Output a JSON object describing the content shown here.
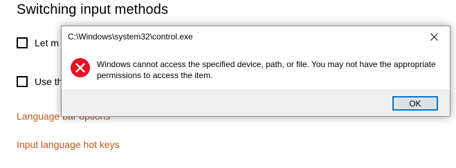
{
  "settings": {
    "section_title": "Switching input methods",
    "checkboxes": [
      {
        "label": "Let m",
        "checked": false
      },
      {
        "label": "Use th",
        "checked": false
      }
    ],
    "links": [
      {
        "label": "Language bar options"
      },
      {
        "label": "Input language hot keys"
      }
    ],
    "link_color": "#c0561a"
  },
  "dialog": {
    "title": "C:\\Windows\\system32\\control.exe",
    "message": "Windows cannot access the specified device, path, or file. You may not have the appropriate permissions to access the item.",
    "icon": "error-icon",
    "ok_label": "OK",
    "accent_color": "#0078d7",
    "error_color": "#e81123"
  }
}
